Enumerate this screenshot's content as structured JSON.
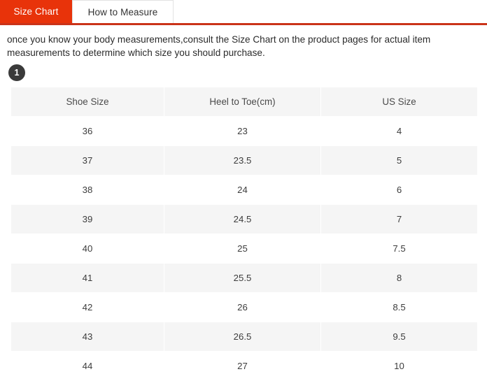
{
  "tabs": [
    {
      "label": "Size Chart",
      "active": true
    },
    {
      "label": "How to Measure",
      "active": false
    }
  ],
  "colors": {
    "active_tab_bg": "#e8330a",
    "underline": "#ca3319",
    "row_shade": "#f5f5f5",
    "badge_bg": "#3a3a3a",
    "text": "#333333"
  },
  "intro": {
    "text": "once you know your body measurements,consult the Size Chart on the product pages for actual item measurements to determine which size you should purchase."
  },
  "step_badge": {
    "number": "1"
  },
  "table": {
    "headers": [
      "Shoe Size",
      "Heel to Toe(cm)",
      "US Size"
    ],
    "rows": [
      [
        "36",
        "23",
        "4"
      ],
      [
        "37",
        "23.5",
        "5"
      ],
      [
        "38",
        "24",
        "6"
      ],
      [
        "39",
        "24.5",
        "7"
      ],
      [
        "40",
        "25",
        "7.5"
      ],
      [
        "41",
        "25.5",
        "8"
      ],
      [
        "42",
        "26",
        "8.5"
      ],
      [
        "43",
        "26.5",
        "9.5"
      ],
      [
        "44",
        "27",
        "10"
      ]
    ]
  }
}
